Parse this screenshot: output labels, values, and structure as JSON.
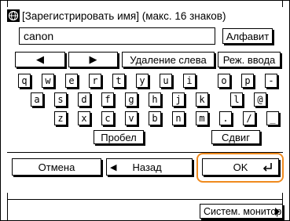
{
  "header": {
    "title": "[Зарегистрировать имя] (макс. 16 знаков)",
    "icon": "globe-icon"
  },
  "input": {
    "value": "canon"
  },
  "mode": {
    "label": "Алфавит"
  },
  "nav": {
    "left_arrow": "◀",
    "right_arrow": "▶",
    "delete_left": "Удаление слева",
    "input_mode": "Реж. ввода"
  },
  "keyboard": {
    "row1": [
      "q",
      "w",
      "e",
      "r",
      "t",
      "y",
      "u",
      "i",
      "o",
      "p",
      "-"
    ],
    "row2": [
      "a",
      "s",
      "d",
      "f",
      "g",
      "h",
      "j",
      "k",
      "l",
      "@"
    ],
    "row3": [
      "z",
      "x",
      "c",
      "v",
      "b",
      "n",
      "m",
      ".",
      "/",
      "_"
    ]
  },
  "space": {
    "label": "Пробел"
  },
  "shift": {
    "label": "Сдвиг"
  },
  "footer": {
    "cancel": "Отмена",
    "back": "Назад",
    "ok": "OK"
  },
  "status": {
    "monitor": "Систем. монитор"
  },
  "colors": {
    "highlight": "#ef8a1e"
  }
}
